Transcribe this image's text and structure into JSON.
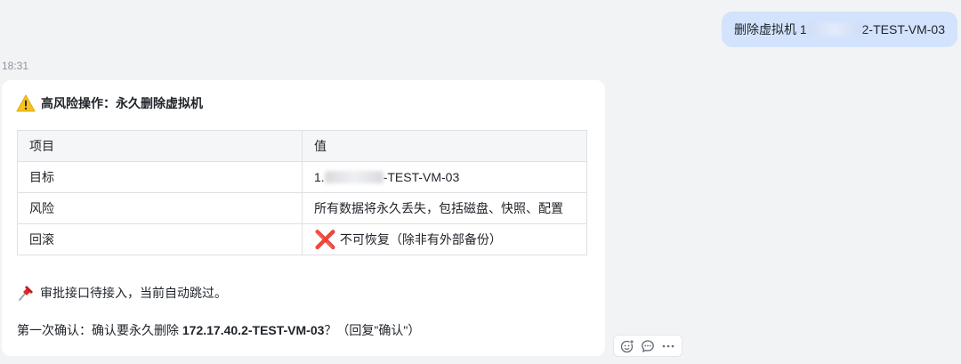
{
  "user_message": {
    "prefix": "删除虚拟机 1",
    "suffix": "2-TEST-VM-03"
  },
  "timestamp": "18:31",
  "card": {
    "title": "高风险操作：永久删除虚拟机",
    "table": {
      "headers": [
        "项目",
        "值"
      ],
      "rows": [
        {
          "item": "目标",
          "value_prefix": "1.",
          "value_suffix": "-TEST-VM-03"
        },
        {
          "item": "风险",
          "value": "所有数据将永久丢失，包括磁盘、快照、配置"
        },
        {
          "item": "回滚",
          "value": "不可恢复（除非有外部备份）",
          "icon": "❌"
        }
      ]
    },
    "note": "审批接口待接入，当前自动跳过。",
    "confirm": {
      "prefix": "第一次确认：确认要永久删除 ",
      "target": "172.17.40.2-TEST-VM-03",
      "suffix": "？（回复\"确认\"）"
    }
  },
  "actions": {
    "icons": [
      "add-emoji-icon",
      "comment-icon",
      "more-icon"
    ]
  },
  "colors": {
    "user_bubble": "#d3e3fd",
    "background": "#f2f3f5",
    "danger": "#e02020"
  }
}
